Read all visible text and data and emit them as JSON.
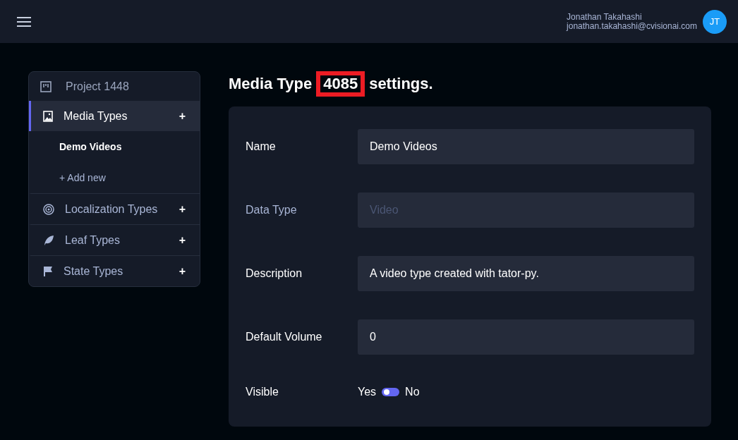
{
  "header": {
    "user_name": "Jonathan Takahashi",
    "user_email": "jonathan.takahashi@cvisionai.com",
    "avatar_initials": "JT"
  },
  "sidebar": {
    "project": "Project 1448",
    "sections": [
      {
        "label": "Media Types",
        "selected": true,
        "add": "+",
        "children": [
          {
            "label": "Demo Videos",
            "kind": "item"
          },
          {
            "label": "+ Add new",
            "kind": "add"
          }
        ]
      },
      {
        "label": "Localization Types",
        "selected": false,
        "add": "+"
      },
      {
        "label": "Leaf Types",
        "selected": false,
        "add": "+"
      },
      {
        "label": "State Types",
        "selected": false,
        "add": "+"
      }
    ]
  },
  "title": {
    "before": "Media Type",
    "highlighted": "4085",
    "after": "settings."
  },
  "form": {
    "fields": [
      {
        "kind": "text",
        "label": "Name",
        "value": "Demo Videos",
        "disabled": false
      },
      {
        "kind": "text",
        "label": "Data Type",
        "value": "Video",
        "disabled": true
      },
      {
        "kind": "text",
        "label": "Description",
        "value": "A video type created with tator-py.",
        "disabled": false
      },
      {
        "kind": "text",
        "label": "Default Volume",
        "value": "0",
        "disabled": false
      },
      {
        "kind": "toggle",
        "label": "Visible",
        "yes": "Yes",
        "no": "No",
        "on": false
      }
    ]
  }
}
